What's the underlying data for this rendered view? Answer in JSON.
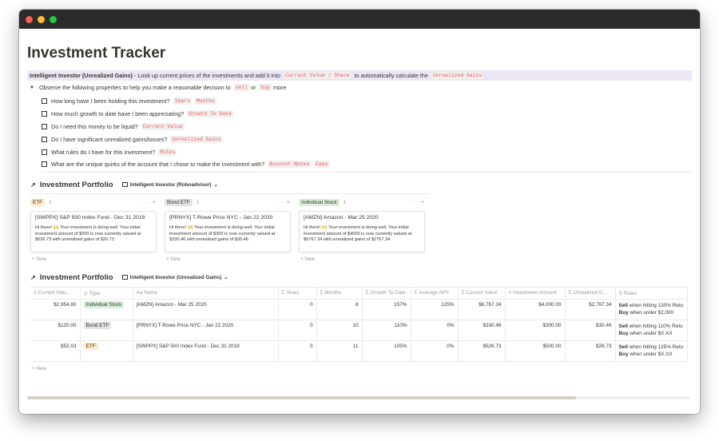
{
  "page": {
    "title": "Investment Tracker",
    "callout": {
      "label": "Intelligent Investor (Unrealized Gains)",
      "text1": " - Look up current prices of the investments and add it into ",
      "code1": "Current Value / Share",
      "text2": " to automatically calculate the ",
      "code2": "Unrealized Gains"
    },
    "toggle": {
      "text1": "Observe the following properties to help you make a reasonable decision to",
      "code1": "sell",
      "text2": "or",
      "code2": "buy",
      "text3": "more"
    },
    "todos": [
      {
        "text": "How long have I been holding this investment?",
        "codes": [
          "Years",
          "Months"
        ]
      },
      {
        "text": "How much growth to date have I been appreciating?",
        "codes": [
          "Growth To Date"
        ]
      },
      {
        "text": "Do I need this money to be liquid?",
        "codes": [
          "Current Value"
        ]
      },
      {
        "text": "Do I have significant unrealized gains/losses?",
        "codes": [
          "Unrealized Gains"
        ]
      },
      {
        "text": "What rules do I have for this investment?",
        "codes": [
          "Rules"
        ]
      },
      {
        "text": "What are the unique quirks of the account that I chose to make the investment with?",
        "codes": [
          "Account Notes",
          "Fees"
        ]
      }
    ]
  },
  "board": {
    "title": "Investment Portfolio",
    "view": "Intelligent Investor (Roboadvisor)",
    "columns": [
      {
        "tag": "ETF",
        "count": "1",
        "new": "New",
        "card_title": "[SWPPX] S&P 500 Index Fund - Dec 31 2019",
        "card_body": "Hi there! 🙌 Your investment is doing well. Your initial investment amount of $500 is now currently valued at $526.73 with unrealized gains of $26.73"
      },
      {
        "tag": "Bond ETF",
        "count": "1",
        "new": "New",
        "card_title": "[PRNYX] T-Rowe Price NYC - Jan 22 2020",
        "card_body": "Hi there! 🙌 Your investment is doing well. Your initial investment amount of $300 is now currently valued at $330.46 with unrealized gains of $30.46"
      },
      {
        "tag": "Individual Stock",
        "count": "1",
        "new": "New",
        "card_title": "[AMZN] Amazon - Mar 25 2020",
        "card_body": "Hi there! 🙌 Your investment is doing well. Your initial investment amount of $4000 is now currently valued at $6767.34 with unrealized gains of $2767.34"
      }
    ],
    "tools": "··· +"
  },
  "table": {
    "title": "Investment Portfolio",
    "view": "Intelligent Investor (Unrealized Gains)",
    "headers": [
      "# Current Valu...",
      "⊙ Type",
      "Aa Name",
      "Σ Years",
      "Σ Months",
      "Σ Growth To Date",
      "Σ Average APY",
      "Σ Current Value",
      "# Investment Amount",
      "Σ Unrealized G...",
      "⚲ Rules"
    ],
    "rows": [
      {
        "cv": "$2,954.80",
        "type": "Individual Stock",
        "name": "[AMZN] Amazon - Mar 25 2020",
        "years": "0",
        "months": "8",
        "growth": "157%",
        "apy": "125%",
        "current": "$6,767.34",
        "invest": "$4,000.00",
        "unreal": "$2,767.34",
        "rule1_b": "Sell",
        "rule1": " when hitting 130% Retu",
        "rule2_b": "Buy",
        "rule2": " when under $2,000"
      },
      {
        "cv": "$120.00",
        "type": "Bond ETF",
        "name": "[PRNYX] T-Rowe Price NYC - Jan 22 2020",
        "years": "0",
        "months": "10",
        "growth": "110%",
        "apy": "0%",
        "current": "$330.46",
        "invest": "$300.00",
        "unreal": "$30.46",
        "rule1_b": "Sell",
        "rule1": " when hitting 110% Retu",
        "rule2_b": "Buy",
        "rule2": " when under $X.XX"
      },
      {
        "cv": "$52.03",
        "type": "ETF",
        "name": "[SWPPX] S&P 500 Index Fund - Dec 31 2019",
        "years": "0",
        "months": "11",
        "growth": "105%",
        "apy": "0%",
        "current": "$526.73",
        "invest": "$500.00",
        "unreal": "$26.73",
        "rule1_b": "Sell",
        "rule1": " when hitting 125% Retu",
        "rule2_b": "Buy",
        "rule2": " when under $X.XX"
      }
    ],
    "new": "New"
  },
  "colors": {
    "callout_bg": "#ebe6f4",
    "code_red": "#eb5757",
    "tag_green": "#dbeddb",
    "tag_gray": "#e3e2e0",
    "tag_yellow": "#fdecc8"
  }
}
